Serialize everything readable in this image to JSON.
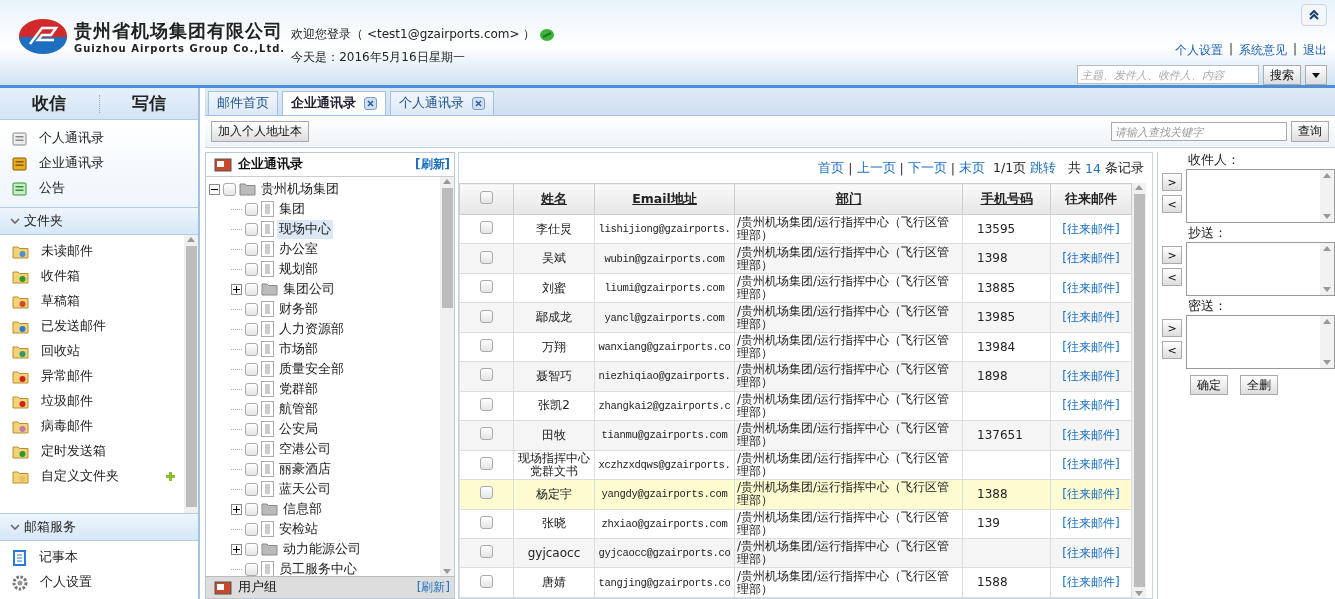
{
  "header": {
    "company_name": "贵州省机场集团有限公司",
    "company_name_en": "Guizhou Airports Group Co.,Ltd.",
    "welcome": "欢迎您登录（  <test1@gzairports.com> ）",
    "date": "今天是：2016年5月16日星期一",
    "links": [
      "个人设置",
      "系统意见",
      "退出"
    ],
    "link_separators": [
      "|",
      "|"
    ],
    "search": {
      "placeholder": "主题、发件人、收件人、内容",
      "button": "搜索"
    }
  },
  "sidebar": {
    "tabs": [
      "收信",
      "写信"
    ],
    "quick_items": [
      "个人通讯录",
      "企业通讯录",
      "公告"
    ],
    "folders": {
      "title": "文件夹",
      "expanded": true,
      "items": [
        "未读邮件",
        "收件箱",
        "草稿箱",
        "已发送邮件",
        "回收站",
        "异常邮件",
        "垃圾邮件",
        "病毒邮件",
        "定时发送箱",
        "自定义文件夹"
      ]
    },
    "services": {
      "title": "邮箱服务",
      "expanded": true,
      "items": [
        "记事本",
        "个人设置"
      ]
    }
  },
  "tabs": [
    {
      "label": "邮件首页",
      "selected": false,
      "closable": false
    },
    {
      "label": "企业通讯录",
      "selected": true,
      "closable": true
    },
    {
      "label": "个人通讯录",
      "selected": false,
      "closable": true
    }
  ],
  "toolbar": {
    "add_button": "加入个人地址本",
    "search_placeholder": "请输入查找关键字",
    "search_button": "查询"
  },
  "tree": {
    "title": "企业通讯录",
    "refresh": "[刷新]",
    "footer_title": "用户组",
    "footer_refresh": "[刷新]",
    "nodes": [
      {
        "label": "贵州机场集团",
        "kind": "folder",
        "expanded": true,
        "checked": false,
        "selected": false,
        "children": [
          {
            "label": "集团",
            "kind": "leaf",
            "checked": false,
            "selected": false
          },
          {
            "label": "现场中心",
            "kind": "leaf",
            "checked": false,
            "selected": true
          },
          {
            "label": "办公室",
            "kind": "leaf",
            "checked": false,
            "selected": false
          },
          {
            "label": "规划部",
            "kind": "leaf",
            "checked": false,
            "selected": false
          },
          {
            "label": "集团公司",
            "kind": "folder",
            "expanded": false,
            "checked": false,
            "selected": false
          },
          {
            "label": "财务部",
            "kind": "leaf",
            "checked": false,
            "selected": false
          },
          {
            "label": "人力资源部",
            "kind": "leaf",
            "checked": false,
            "selected": false
          },
          {
            "label": "市场部",
            "kind": "leaf",
            "checked": false,
            "selected": false
          },
          {
            "label": "质量安全部",
            "kind": "leaf",
            "checked": false,
            "selected": false
          },
          {
            "label": "党群部",
            "kind": "leaf",
            "checked": false,
            "selected": false
          },
          {
            "label": "航管部",
            "kind": "leaf",
            "checked": false,
            "selected": false
          },
          {
            "label": "公安局",
            "kind": "leaf",
            "checked": false,
            "selected": false
          },
          {
            "label": "空港公司",
            "kind": "leaf",
            "checked": false,
            "selected": false
          },
          {
            "label": "丽豪酒店",
            "kind": "leaf",
            "checked": false,
            "selected": false
          },
          {
            "label": "蓝天公司",
            "kind": "leaf",
            "checked": false,
            "selected": false
          },
          {
            "label": "信息部",
            "kind": "folder",
            "expanded": false,
            "checked": false,
            "selected": false
          },
          {
            "label": "安检站",
            "kind": "leaf",
            "checked": false,
            "selected": false
          },
          {
            "label": "动力能源公司",
            "kind": "folder",
            "expanded": false,
            "checked": false,
            "selected": false
          },
          {
            "label": "员工服务中心",
            "kind": "leaf",
            "checked": false,
            "selected": false
          }
        ]
      }
    ]
  },
  "pager": {
    "links": [
      "首页",
      "上一页",
      "下一页",
      "末页"
    ],
    "separators": [
      "|",
      "|",
      "|"
    ],
    "page": "1/1页",
    "jump": "跳转",
    "total_prefix": "共",
    "total": "14",
    "total_suffix": "条记录"
  },
  "table": {
    "header_checked": false,
    "columns": [
      "姓名",
      "Email地址",
      "部门",
      "手机号码",
      "往来邮件"
    ],
    "rows": [
      {
        "name": "李仕炅",
        "email": "lishijiong@gzairports.",
        "dept": "/贵州机场集团/运行指挥中心（飞行区管理部）",
        "phone": "13595",
        "mail": "[往来邮件]",
        "checked": false,
        "selected": false
      },
      {
        "name": "吴斌",
        "email": "wubin@gzairports.com",
        "dept": "/贵州机场集团/运行指挥中心（飞行区管理部）",
        "phone": "1398",
        "mail": "[往来邮件]",
        "checked": false,
        "selected": false
      },
      {
        "name": "刘蜜",
        "email": "liumi@gzairports.com",
        "dept": "/贵州机场集团/运行指挥中心（飞行区管理部）",
        "phone": "13885",
        "mail": "[往来邮件]",
        "checked": false,
        "selected": false
      },
      {
        "name": "鄢成龙",
        "email": "yancl@gzairports.com",
        "dept": "/贵州机场集团/运行指挥中心（飞行区管理部）",
        "phone": "13985",
        "mail": "[往来邮件]",
        "checked": false,
        "selected": false
      },
      {
        "name": "万翔",
        "email": "wanxiang@gzairports.co",
        "dept": "/贵州机场集团/运行指挥中心（飞行区管理部）",
        "phone": "13984",
        "mail": "[往来邮件]",
        "checked": false,
        "selected": false
      },
      {
        "name": "聂智巧",
        "email": "niezhiqiao@gzairports.",
        "dept": "/贵州机场集团/运行指挥中心（飞行区管理部）",
        "phone": "1898",
        "mail": "[往来邮件]",
        "checked": false,
        "selected": false
      },
      {
        "name": "张凯2",
        "email": "zhangkai2@gzairports.c",
        "dept": "/贵州机场集团/运行指挥中心（飞行区管理部）",
        "mail": "[往来邮件]",
        "checked": false,
        "selected": false
      },
      {
        "name": "田牧",
        "email": "tianmu@gzairports.com",
        "dept": "/贵州机场集团/运行指挥中心（飞行区管理部）",
        "phone": "137651",
        "mail": "[往来邮件]",
        "checked": false,
        "selected": false
      },
      {
        "name": "现场指挥中心党群文书",
        "email": "xczhzxdqws@gzairports.",
        "dept": "/贵州机场集团/运行指挥中心（飞行区管理部）",
        "mail": "[往来邮件]",
        "checked": false,
        "selected": false
      },
      {
        "name": "杨定宇",
        "email": "yangdy@gzairports.com",
        "dept": "/贵州机场集团/运行指挥中心（飞行区管理部）",
        "phone": "1388",
        "mail": "[往来邮件]",
        "checked": false,
        "selected": true
      },
      {
        "name": "张晓",
        "email": "zhxiao@gzairports.com",
        "dept": "/贵州机场集团/运行指挥中心（飞行区管理部）",
        "phone": "139",
        "mail": "[往来邮件]",
        "checked": false,
        "selected": false
      },
      {
        "name": "gyjcaocc",
        "email": "gyjcaocc@gzairports.co",
        "dept": "/贵州机场集团/运行指挥中心（飞行区管理部）",
        "mail": "[往来邮件]",
        "checked": false,
        "selected": false
      },
      {
        "name": "唐婧",
        "email": "tangjing@gzairports.co",
        "dept": "/贵州机场集团/运行指挥中心（飞行区管理部）",
        "phone": "1588",
        "mail": "[往来邮件]",
        "checked": false,
        "selected": false
      }
    ]
  },
  "recipients": {
    "fields": [
      {
        "label": "收件人：",
        "add": ">",
        "remove": "<"
      },
      {
        "label": "抄送：",
        "add": ">",
        "remove": "<"
      },
      {
        "label": "密送：",
        "add": ">",
        "remove": "<"
      }
    ],
    "buttons": [
      "确定",
      "全删"
    ]
  }
}
